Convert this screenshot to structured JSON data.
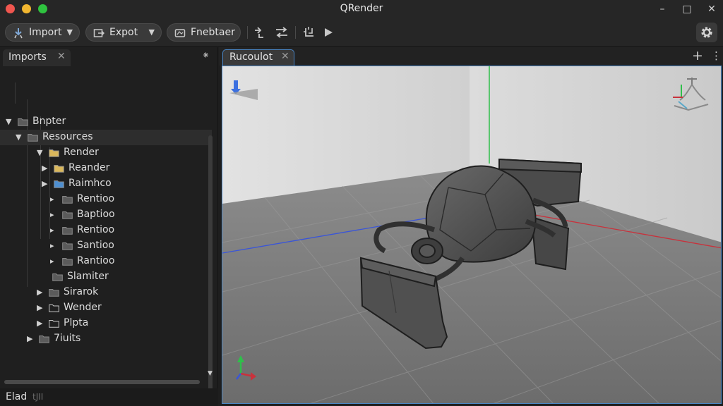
{
  "app": {
    "title": "QRender"
  },
  "window_controls": {
    "minimize": "–",
    "maximize": "□",
    "close": "✕"
  },
  "toolbar": {
    "import_label": "Import",
    "export_label": "Expot",
    "third_label": "Fnebtaer",
    "caret": "▼"
  },
  "left_panel": {
    "tab_label": "Imports",
    "tab_close": "✕",
    "pin": "⁕",
    "tree": [
      {
        "label": "Bnpter",
        "arrow": "▼",
        "folder": "dark"
      },
      {
        "label": "Resources",
        "arrow": "▼",
        "folder": "dark"
      },
      {
        "label": "Render",
        "arrow": "▼",
        "folder": "yellow"
      },
      {
        "label": "Reander",
        "arrow": "▶",
        "folder": "yellow"
      },
      {
        "label": "Raimhco",
        "arrow": "▶",
        "folder": "blue"
      },
      {
        "label": "Rentioo",
        "arrow": "▸",
        "folder": "dark"
      },
      {
        "label": "Baptioo",
        "arrow": "▸",
        "folder": "dark"
      },
      {
        "label": "Rentioo",
        "arrow": "▸",
        "folder": "dark"
      },
      {
        "label": "Santioo",
        "arrow": "▸",
        "folder": "dark"
      },
      {
        "label": "Rantioo",
        "arrow": "▸",
        "folder": "dark"
      },
      {
        "label": "Slamiter",
        "arrow": "",
        "folder": "dark"
      },
      {
        "label": "Sirarok",
        "arrow": "▶",
        "folder": "dark"
      },
      {
        "label": "Wender",
        "arrow": "▶",
        "folder": "outline"
      },
      {
        "label": "Plpta",
        "arrow": "▶",
        "folder": "outline"
      },
      {
        "label": "7iuits",
        "arrow": "▶",
        "folder": "dark"
      }
    ],
    "status_text": "Elad",
    "status_sub": "tJII"
  },
  "viewport": {
    "tab_label": "Rucoulot",
    "tab_close": "✕",
    "add": "+",
    "more": "⋮"
  },
  "colors": {
    "accent": "#4a86c5",
    "y_axis": "#2fbf4a",
    "x_axis": "#c8323c",
    "z_axis": "#3a55d8"
  },
  "icons": {
    "import": "import-icon",
    "export": "export-icon",
    "render": "render-icon",
    "settings": "gear-icon"
  }
}
